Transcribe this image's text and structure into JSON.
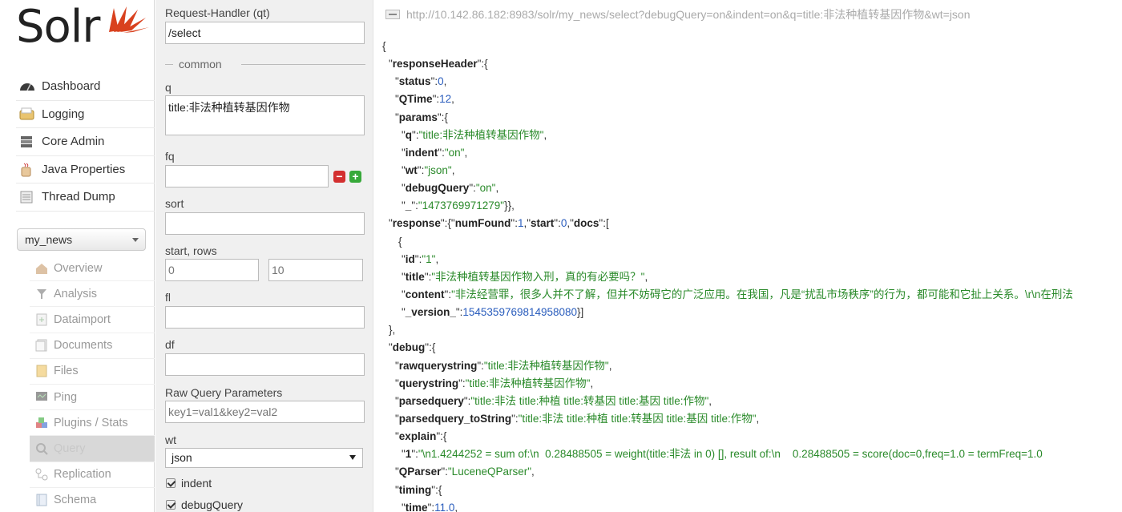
{
  "brand": {
    "logo_text": "Solr"
  },
  "nav": {
    "main_items": [
      {
        "label": "Dashboard",
        "icon": "dashboard-icon"
      },
      {
        "label": "Logging",
        "icon": "logging-icon"
      },
      {
        "label": "Core Admin",
        "icon": "core-admin-icon"
      },
      {
        "label": "Java Properties",
        "icon": "java-icon"
      },
      {
        "label": "Thread Dump",
        "icon": "thread-dump-icon"
      }
    ],
    "core_selector": {
      "selected": "my_news"
    },
    "core_items": [
      {
        "label": "Overview",
        "icon": "overview-icon"
      },
      {
        "label": "Analysis",
        "icon": "analysis-icon"
      },
      {
        "label": "Dataimport",
        "icon": "dataimport-icon"
      },
      {
        "label": "Documents",
        "icon": "documents-icon"
      },
      {
        "label": "Files",
        "icon": "files-icon"
      },
      {
        "label": "Ping",
        "icon": "ping-icon"
      },
      {
        "label": "Plugins / Stats",
        "icon": "plugins-icon"
      },
      {
        "label": "Query",
        "icon": "query-icon",
        "active": true
      },
      {
        "label": "Replication",
        "icon": "replication-icon"
      },
      {
        "label": "Schema",
        "icon": "schema-icon"
      }
    ]
  },
  "form": {
    "qt_label": "Request-Handler (qt)",
    "qt_value": "/select",
    "section_common": "common",
    "q_label": "q",
    "q_value": "title:非法种植转基因作物",
    "fq_label": "fq",
    "fq_value": "",
    "sort_label": "sort",
    "sort_value": "",
    "start_rows_label": "start, rows",
    "start_placeholder": "0",
    "rows_placeholder": "10",
    "fl_label": "fl",
    "fl_value": "",
    "df_label": "df",
    "df_value": "",
    "raw_label": "Raw Query Parameters",
    "raw_placeholder": "key1=val1&key2=val2",
    "wt_label": "wt",
    "wt_value": "json",
    "indent_label": "indent",
    "debug_label": "debugQuery"
  },
  "result": {
    "url": "http://10.142.86.182:8983/solr/my_news/select?debugQuery=on&indent=on&q=title:非法种植转基因作物&wt=json",
    "lines": [
      {
        "indent": 0,
        "parts": [
          [
            "p",
            "{"
          ]
        ]
      },
      {
        "indent": 1,
        "parts": [
          [
            "p",
            "\""
          ],
          [
            "k",
            "responseHeader"
          ],
          [
            "p",
            "\":{"
          ]
        ]
      },
      {
        "indent": 2,
        "parts": [
          [
            "p",
            "\""
          ],
          [
            "k",
            "status"
          ],
          [
            "p",
            "\":"
          ],
          [
            "n",
            "0"
          ],
          [
            "p",
            ","
          ]
        ]
      },
      {
        "indent": 2,
        "parts": [
          [
            "p",
            "\""
          ],
          [
            "k",
            "QTime"
          ],
          [
            "p",
            "\":"
          ],
          [
            "n",
            "12"
          ],
          [
            "p",
            ","
          ]
        ]
      },
      {
        "indent": 2,
        "parts": [
          [
            "p",
            "\""
          ],
          [
            "k",
            "params"
          ],
          [
            "p",
            "\":{"
          ]
        ]
      },
      {
        "indent": 3,
        "parts": [
          [
            "p",
            "\""
          ],
          [
            "k",
            "q"
          ],
          [
            "p",
            "\":"
          ],
          [
            "s",
            "\"title:非法种植转基因作物\""
          ],
          [
            "p",
            ","
          ]
        ]
      },
      {
        "indent": 3,
        "parts": [
          [
            "p",
            "\""
          ],
          [
            "k",
            "indent"
          ],
          [
            "p",
            "\":"
          ],
          [
            "s",
            "\"on\""
          ],
          [
            "p",
            ","
          ]
        ]
      },
      {
        "indent": 3,
        "parts": [
          [
            "p",
            "\""
          ],
          [
            "k",
            "wt"
          ],
          [
            "p",
            "\":"
          ],
          [
            "s",
            "\"json\""
          ],
          [
            "p",
            ","
          ]
        ]
      },
      {
        "indent": 3,
        "parts": [
          [
            "p",
            "\""
          ],
          [
            "k",
            "debugQuery"
          ],
          [
            "p",
            "\":"
          ],
          [
            "s",
            "\"on\""
          ],
          [
            "p",
            ","
          ]
        ]
      },
      {
        "indent": 3,
        "parts": [
          [
            "p",
            "\""
          ],
          [
            "k",
            "_"
          ],
          [
            "p",
            "\":"
          ],
          [
            "s",
            "\"1473769971279\""
          ],
          [
            "p",
            "}},"
          ]
        ]
      },
      {
        "indent": 1,
        "parts": [
          [
            "p",
            "\""
          ],
          [
            "k",
            "response"
          ],
          [
            "p",
            "\":{\""
          ],
          [
            "k",
            "numFound"
          ],
          [
            "p",
            "\":"
          ],
          [
            "n",
            "1"
          ],
          [
            "p",
            ",\""
          ],
          [
            "k",
            "start"
          ],
          [
            "p",
            "\":"
          ],
          [
            "n",
            "0"
          ],
          [
            "p",
            ",\""
          ],
          [
            "k",
            "docs"
          ],
          [
            "p",
            "\":["
          ]
        ]
      },
      {
        "indent": 2.5,
        "parts": [
          [
            "p",
            "{"
          ]
        ]
      },
      {
        "indent": 3,
        "parts": [
          [
            "p",
            "\""
          ],
          [
            "k",
            "id"
          ],
          [
            "p",
            "\":"
          ],
          [
            "s",
            "\"1\""
          ],
          [
            "p",
            ","
          ]
        ]
      },
      {
        "indent": 3,
        "parts": [
          [
            "p",
            "\""
          ],
          [
            "k",
            "title"
          ],
          [
            "p",
            "\":"
          ],
          [
            "s",
            "\"非法种植转基因作物入刑，真的有必要吗？\""
          ],
          [
            "p",
            ","
          ]
        ]
      },
      {
        "indent": 3,
        "parts": [
          [
            "p",
            "\""
          ],
          [
            "k",
            "content"
          ],
          [
            "p",
            "\":"
          ],
          [
            "s",
            "\"非法经营罪，很多人并不了解，但并不妨碍它的广泛应用。在我国，凡是“扰乱市场秩序”的行为，都可能和它扯上关系。\\r\\n在刑法"
          ]
        ]
      },
      {
        "indent": 3,
        "parts": [
          [
            "p",
            "\""
          ],
          [
            "k",
            "_version_"
          ],
          [
            "p",
            "\":"
          ],
          [
            "n",
            "1545359769814958080"
          ],
          [
            "p",
            "}]"
          ]
        ]
      },
      {
        "indent": 1,
        "parts": [
          [
            "p",
            "},"
          ]
        ]
      },
      {
        "indent": 1,
        "parts": [
          [
            "p",
            "\""
          ],
          [
            "k",
            "debug"
          ],
          [
            "p",
            "\":{"
          ]
        ]
      },
      {
        "indent": 2,
        "parts": [
          [
            "p",
            "\""
          ],
          [
            "k",
            "rawquerystring"
          ],
          [
            "p",
            "\":"
          ],
          [
            "s",
            "\"title:非法种植转基因作物\""
          ],
          [
            "p",
            ","
          ]
        ]
      },
      {
        "indent": 2,
        "parts": [
          [
            "p",
            "\""
          ],
          [
            "k",
            "querystring"
          ],
          [
            "p",
            "\":"
          ],
          [
            "s",
            "\"title:非法种植转基因作物\""
          ],
          [
            "p",
            ","
          ]
        ]
      },
      {
        "indent": 2,
        "parts": [
          [
            "p",
            "\""
          ],
          [
            "k",
            "parsedquery"
          ],
          [
            "p",
            "\":"
          ],
          [
            "s",
            "\"title:非法 title:种植 title:转基因 title:基因 title:作物\""
          ],
          [
            "p",
            ","
          ]
        ]
      },
      {
        "indent": 2,
        "parts": [
          [
            "p",
            "\""
          ],
          [
            "k",
            "parsedquery_toString"
          ],
          [
            "p",
            "\":"
          ],
          [
            "s",
            "\"title:非法 title:种植 title:转基因 title:基因 title:作物\""
          ],
          [
            "p",
            ","
          ]
        ]
      },
      {
        "indent": 2,
        "parts": [
          [
            "p",
            "\""
          ],
          [
            "k",
            "explain"
          ],
          [
            "p",
            "\":{"
          ]
        ]
      },
      {
        "indent": 3,
        "parts": [
          [
            "p",
            "\""
          ],
          [
            "k",
            "1"
          ],
          [
            "p",
            "\":"
          ],
          [
            "s",
            "\"\\n1.4244252 = sum of:\\n  0.28488505 = weight(title:非法 in 0) [], result of:\\n    0.28488505 = score(doc=0,freq=1.0 = termFreq=1.0"
          ]
        ]
      },
      {
        "indent": 2,
        "parts": [
          [
            "p",
            "\""
          ],
          [
            "k",
            "QParser"
          ],
          [
            "p",
            "\":"
          ],
          [
            "s",
            "\"LuceneQParser\""
          ],
          [
            "p",
            ","
          ]
        ]
      },
      {
        "indent": 2,
        "parts": [
          [
            "p",
            "\""
          ],
          [
            "k",
            "timing"
          ],
          [
            "p",
            "\":{"
          ]
        ]
      },
      {
        "indent": 3,
        "parts": [
          [
            "p",
            "\""
          ],
          [
            "k",
            "time"
          ],
          [
            "p",
            "\":"
          ],
          [
            "n",
            "11.0"
          ],
          [
            "p",
            ","
          ]
        ]
      }
    ]
  }
}
